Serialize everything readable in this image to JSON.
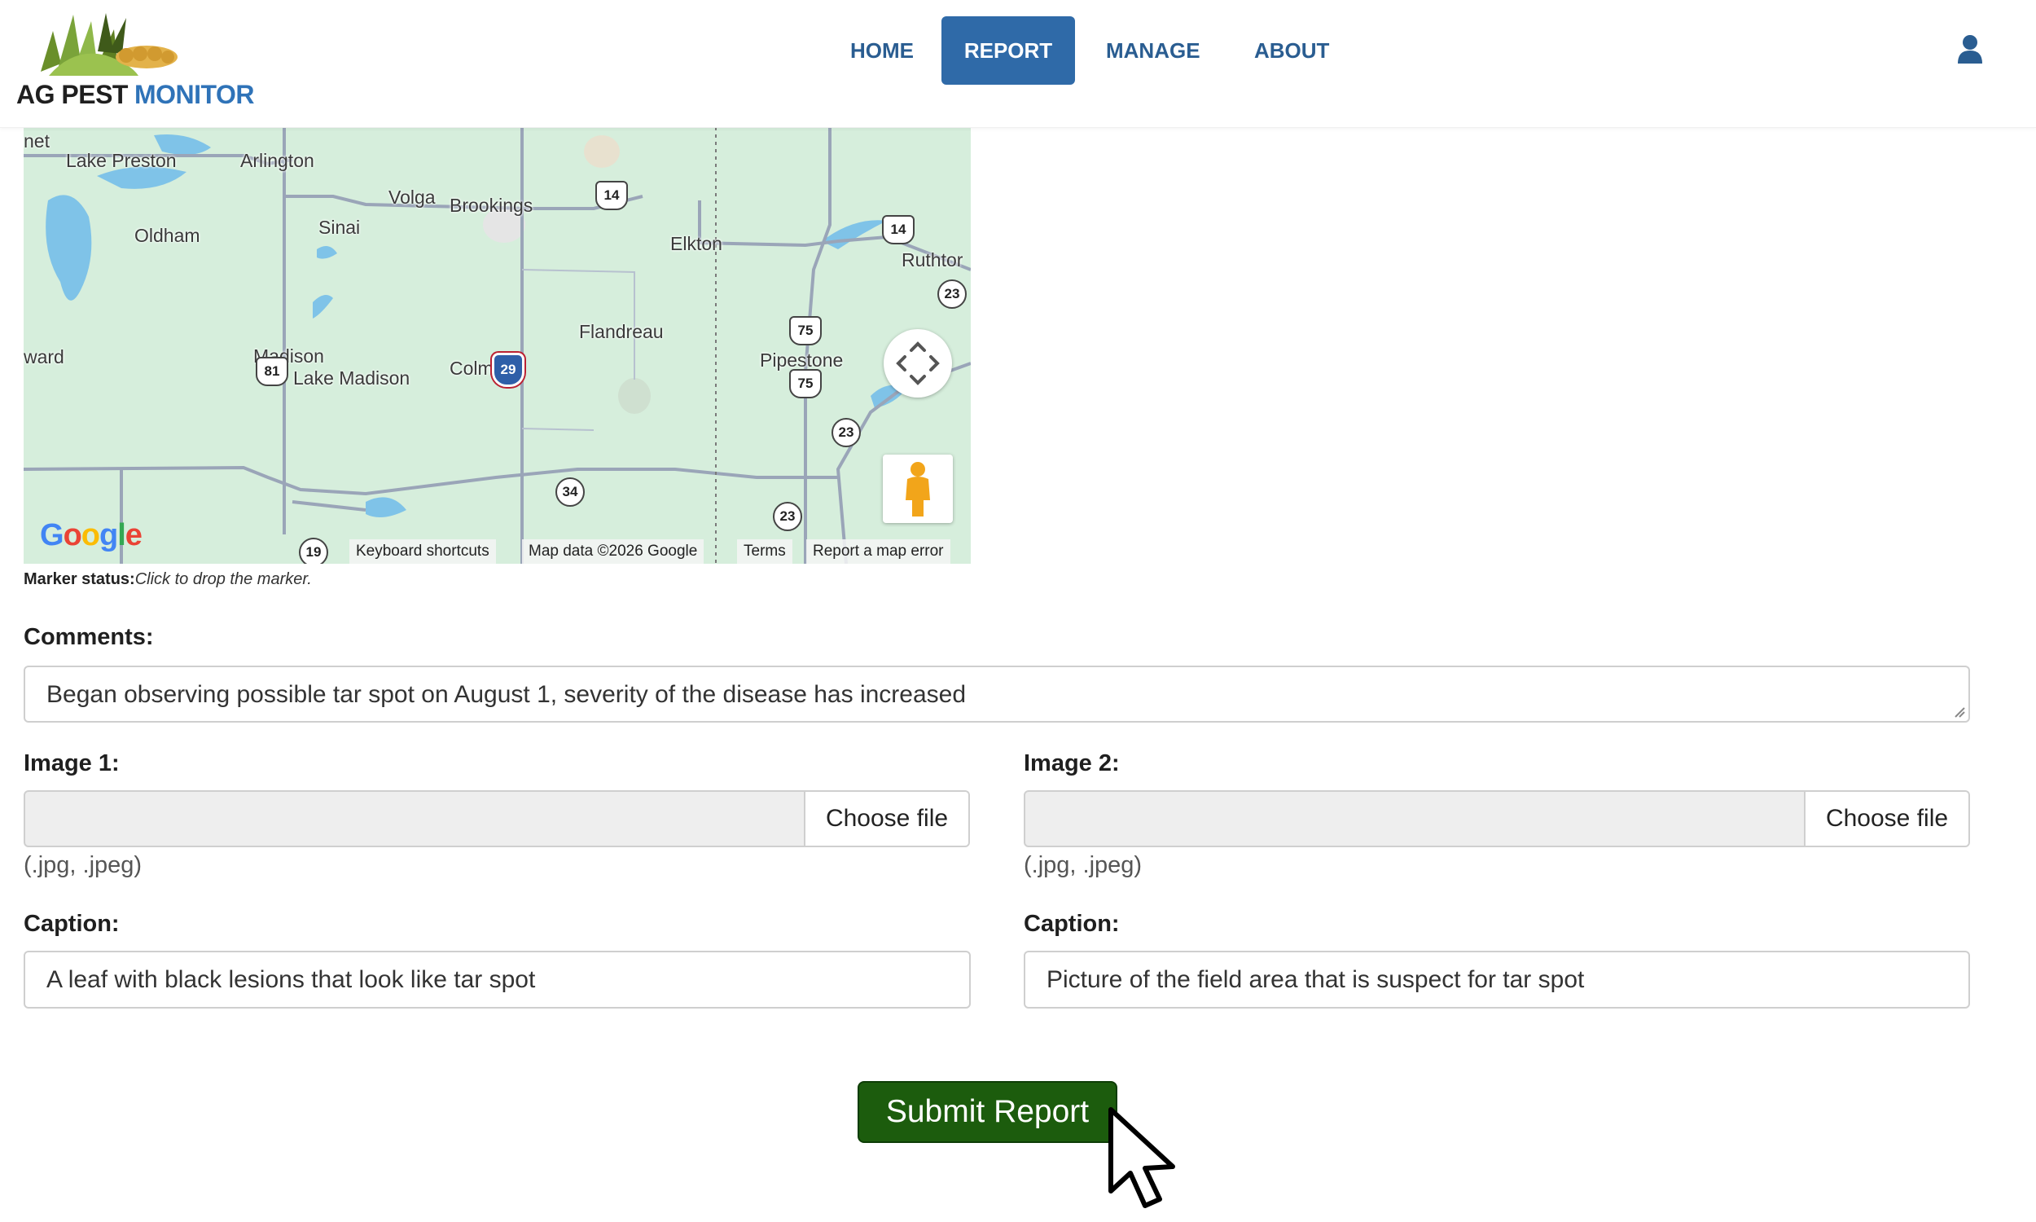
{
  "brand": {
    "part1": "AG PEST",
    "part2": "MONITOR"
  },
  "nav": {
    "items": [
      {
        "label": "HOME"
      },
      {
        "label": "REPORT"
      },
      {
        "label": "MANAGE"
      },
      {
        "label": "ABOUT"
      }
    ],
    "active": "REPORT",
    "user_icon": "user-icon"
  },
  "map": {
    "places": [
      "net",
      "Lake Preston",
      "Arlington",
      "Volga",
      "Brookings",
      "Elkton",
      "Oldham",
      "Sinai",
      "Ruthtor",
      "Flandreau",
      "ward",
      "Madison",
      "Lake Madison",
      "Colman",
      "Pipestone"
    ],
    "shields": [
      "14",
      "14",
      "23",
      "75",
      "75",
      "23",
      "81",
      "29",
      "34",
      "23",
      "19"
    ],
    "google": "Google",
    "footer": {
      "shortcuts": "Keyboard shortcuts",
      "data": "Map data ©2026 Google",
      "terms": "Terms",
      "report": "Report a map error"
    },
    "controls": [
      "move-arrows-icon",
      "pegman-icon"
    ]
  },
  "marker_status": {
    "label": "Marker status:",
    "value": "Click to drop the marker."
  },
  "form": {
    "comments_label": "Comments:",
    "comments_value": "Began observing possible tar spot on August 1, severity of the disease has increased",
    "image1_label": "Image 1:",
    "image2_label": "Image 2:",
    "choose_file": "Choose file",
    "file_hint": "(.jpg, .jpeg)",
    "caption_label": "Caption:",
    "caption1_value": "A leaf with black lesions that look like tar spot",
    "caption2_value": "Picture of the field area that is suspect for tar spot",
    "submit_label": "Submit Report"
  },
  "colors": {
    "nav_text": "#2a5d91",
    "nav_active_bg": "#2f6aa8",
    "submit_bg": "#1c5c0d",
    "map_land": "#d6eedc",
    "map_water": "#7fc3e8"
  }
}
